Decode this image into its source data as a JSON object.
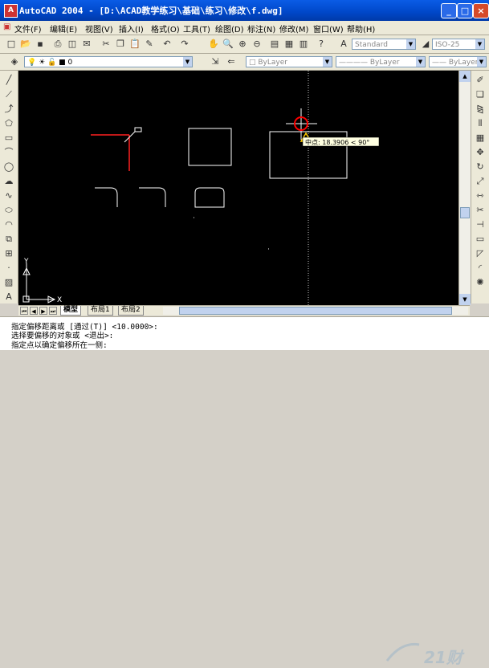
{
  "window": {
    "title": "AutoCAD 2004 - [D:\\ACAD教学练习\\基础\\练习\\修改\\f.dwg]",
    "minimize": "_",
    "maximize": "□",
    "close": "×"
  },
  "menu": {
    "items": [
      "文件(F)",
      "编辑(E)",
      "视图(V)",
      "插入(I)",
      "格式(O)",
      "工具(T)",
      "绘图(D)",
      "标注(N)",
      "修改(M)",
      "窗口(W)",
      "帮助(H)"
    ]
  },
  "toolbar": {
    "text_style": "Standard",
    "dim_style": "ISO-25",
    "layer": "0",
    "color": "ByLayer",
    "linetype": "ByLayer",
    "lineweight": "ByLayer"
  },
  "layout_tabs": [
    "模型",
    "布局1",
    "布局2"
  ],
  "drawing": {
    "tooltip": "中点: 18.3906 < 90°",
    "ucs_x": "X",
    "ucs_y": "Y"
  },
  "command": {
    "line1": "指定偏移距离或 [通过(T)] <10.0000>:",
    "line2": "选择要偏移的对象或 <退出>:",
    "line3": "指定点以确定偏移所在一侧:"
  },
  "watermark": {
    "text": "21财"
  },
  "colors": {
    "titlebar": "#0054e3",
    "canvas": "#000000",
    "cursor": "#ff0000"
  }
}
